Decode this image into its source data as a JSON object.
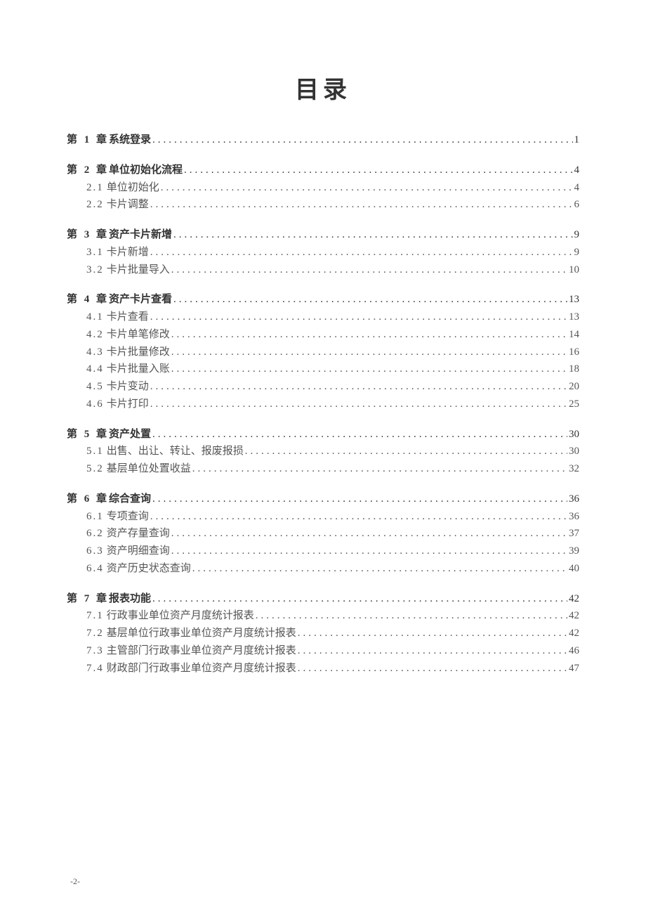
{
  "title": "目录",
  "chapters": [
    {
      "prefix": "第 1 章",
      "label": "系统登录",
      "page": "1",
      "sections": []
    },
    {
      "prefix": "第 2 章",
      "label": "单位初始化流程",
      "page": "4",
      "sections": [
        {
          "num": "2.1",
          "label": "单位初始化",
          "page": "4"
        },
        {
          "num": "2.2",
          "label": "卡片调整",
          "page": "6"
        }
      ]
    },
    {
      "prefix": "第 3 章",
      "label": "资产卡片新增",
      "page": "9",
      "sections": [
        {
          "num": "3.1",
          "label": "卡片新增",
          "page": "9"
        },
        {
          "num": "3.2",
          "label": "卡片批量导入",
          "page": "10"
        }
      ]
    },
    {
      "prefix": "第 4 章",
      "label": "资产卡片查看",
      "page": "13",
      "sections": [
        {
          "num": "4.1",
          "label": "卡片查看",
          "page": "13"
        },
        {
          "num": "4.2",
          "label": "卡片单笔修改",
          "page": "14"
        },
        {
          "num": "4.3",
          "label": "卡片批量修改",
          "page": "16"
        },
        {
          "num": "4.4",
          "label": "卡片批量入账",
          "page": "18"
        },
        {
          "num": "4.5",
          "label": "卡片变动",
          "page": "20"
        },
        {
          "num": "4.6",
          "label": "卡片打印",
          "page": "25"
        }
      ]
    },
    {
      "prefix": "第 5 章",
      "label": "资产处置",
      "page": "30",
      "sections": [
        {
          "num": "5.1",
          "label": "出售、出让、转让、报废报损",
          "page": "30"
        },
        {
          "num": "5.2",
          "label": "基层单位处置收益",
          "page": "32"
        }
      ]
    },
    {
      "prefix": "第 6 章",
      "label": "综合查询",
      "page": "36",
      "sections": [
        {
          "num": "6.1",
          "label": "专项查询",
          "page": "36"
        },
        {
          "num": "6.2",
          "label": "资产存量查询",
          "page": "37"
        },
        {
          "num": "6.3",
          "label": "资产明细查询",
          "page": "39"
        },
        {
          "num": "6.4",
          "label": "资产历史状态查询",
          "page": "40"
        }
      ]
    },
    {
      "prefix": "第 7 章",
      "label": "报表功能",
      "page": "42",
      "sections": [
        {
          "num": "7.1",
          "label": "行政事业单位资产月度统计报表",
          "page": "42"
        },
        {
          "num": "7.2",
          "label": "基层单位行政事业单位资产月度统计报表",
          "page": "42"
        },
        {
          "num": "7.3",
          "label": "主管部门行政事业单位资产月度统计报表",
          "page": "46"
        },
        {
          "num": "7.4",
          "label": "财政部门行政事业单位资产月度统计报表",
          "page": "47"
        }
      ]
    }
  ],
  "page_number": "-2-"
}
